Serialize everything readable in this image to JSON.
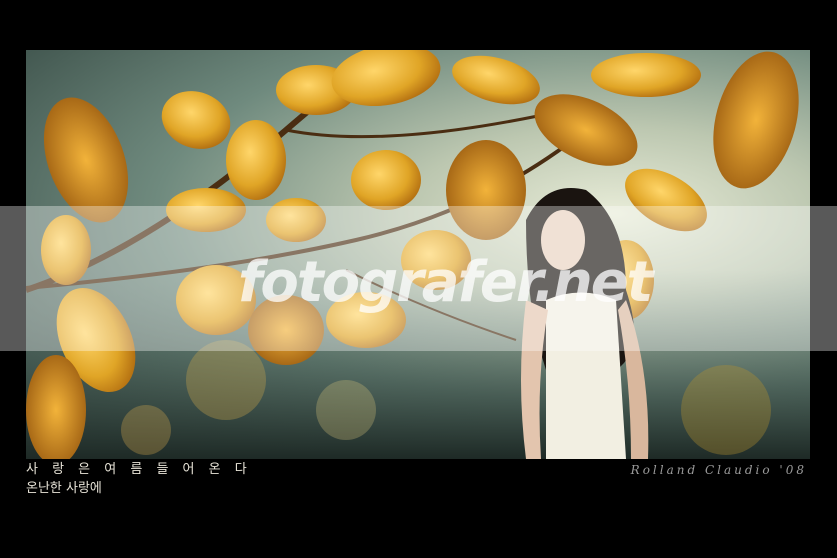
{
  "watermark": "fotografer.net",
  "caption": {
    "line1": "사 랑 은  여 름 들 어 온 다",
    "line2": "온난한 사랑에"
  },
  "signature": "Rolland Claudio '08",
  "colors": {
    "frame": "#000000",
    "leaf": "#e0a526",
    "leaf_dark": "#b06a10",
    "dress": "#f2efe2"
  }
}
